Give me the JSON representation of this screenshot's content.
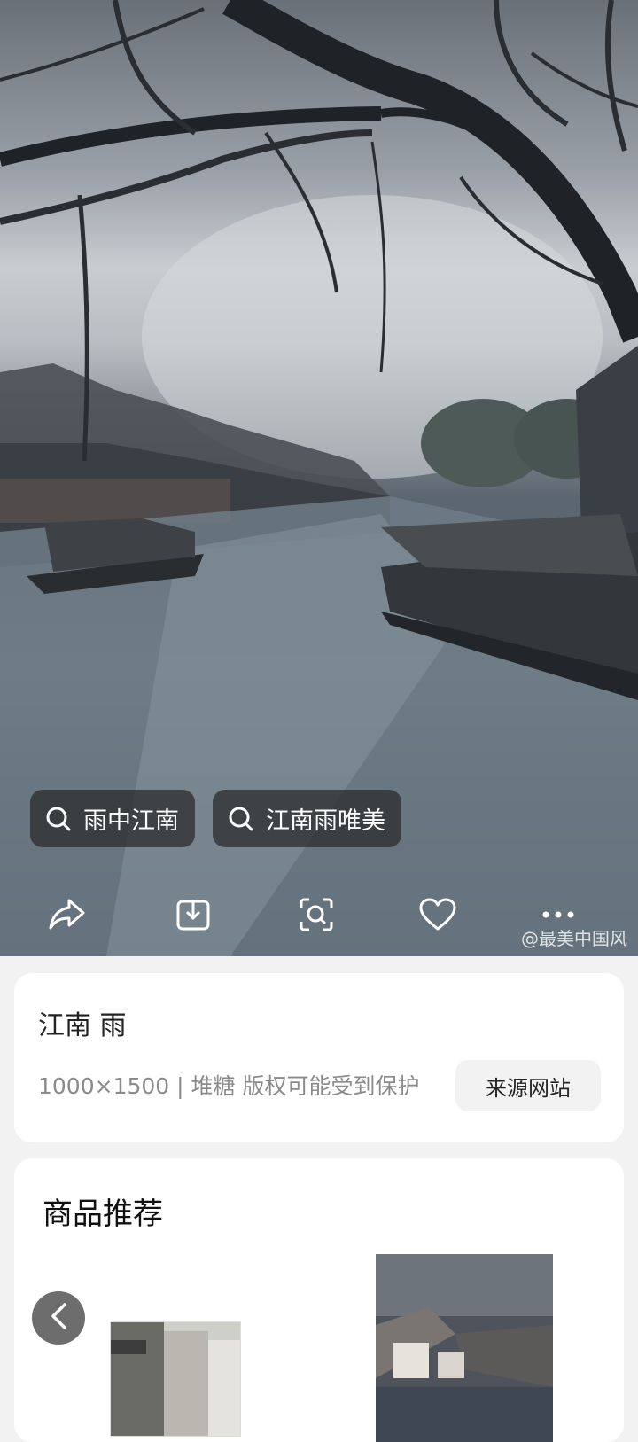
{
  "hero": {
    "tags": [
      {
        "icon": "search-icon",
        "label": "雨中江南"
      },
      {
        "icon": "search-icon",
        "label": "江南雨唯美"
      }
    ],
    "actions": [
      "share-icon",
      "download-icon",
      "visual-search-icon",
      "heart-icon",
      "more-icon"
    ],
    "watermark": "@最美中国风"
  },
  "info": {
    "title": "江南 雨",
    "meta": "1000×1500 | 堆糖 版权可能受到保护",
    "source_button": "来源网站"
  },
  "products": {
    "heading": "商品推荐"
  }
}
